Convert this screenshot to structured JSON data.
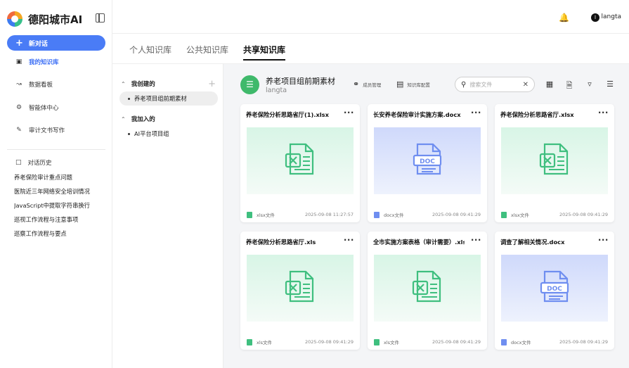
{
  "app": {
    "name": "德阳城市AI"
  },
  "sidebar": {
    "new_chat_label": "新对话",
    "nav": [
      {
        "label": "我的知识库",
        "icon": "knowledge-base-icon",
        "active": true
      },
      {
        "label": "数据看板",
        "icon": "chart-icon",
        "active": false
      },
      {
        "label": "智能体中心",
        "icon": "agent-gear-icon",
        "active": false
      },
      {
        "label": "审计文书写作",
        "icon": "edit-document-icon",
        "active": false
      }
    ],
    "history_title": "对话历史",
    "history": [
      "养老保险审计重点问题",
      "医院近三年网络安全培训情况",
      "JavaScript中提取字符串换行符",
      "巡视工作流程与注意事项",
      "巡察工作流程与要点"
    ]
  },
  "topbar": {
    "avatar_initial": "l",
    "username": "langta"
  },
  "tabs": [
    {
      "label": "个人知识库",
      "active": false
    },
    {
      "label": "公共知识库",
      "active": false
    },
    {
      "label": "共享知识库",
      "active": true
    }
  ],
  "tree": {
    "created_title": "我创建的",
    "created_items": [
      "养老项目组前期素材"
    ],
    "joined_title": "我加入的",
    "joined_items": [
      "AI平台项目组"
    ]
  },
  "kb": {
    "title": "养老项目组前期素材",
    "owner": "langta",
    "members_label": "成员管理",
    "config_label": "知识库配置",
    "search_placeholder": "搜索文件"
  },
  "files": [
    {
      "name": "养老保险分析思路省厅(1).xlsx",
      "type": "xlsx文件",
      "kind": "xls",
      "date": "2025-09-08 11:27:57"
    },
    {
      "name": "长安养老保险审计实施方案.docx",
      "type": "docx文件",
      "kind": "doc",
      "date": "2025-09-08 09:41:29"
    },
    {
      "name": "养老保险分析思路省厅.xlsx",
      "type": "xlsx文件",
      "kind": "xls",
      "date": "2025-09-08 09:41:29"
    },
    {
      "name": "养老保险分析思路省厅.xls",
      "type": "xls文件",
      "kind": "xls",
      "date": "2025-09-08 09:41:29"
    },
    {
      "name": "全市实施方案表格（审计需要）.xls",
      "type": "xls文件",
      "kind": "xls",
      "date": "2025-09-08 09:41:29"
    },
    {
      "name": "调查了解相关情况.docx",
      "type": "docx文件",
      "kind": "doc",
      "date": "2025-09-08 09:41:29"
    }
  ],
  "colors": {
    "accent": "#4a7cf6",
    "xls": "#3fbf7f",
    "doc": "#6f8ef0",
    "kb_icon": "#3fb96b"
  }
}
